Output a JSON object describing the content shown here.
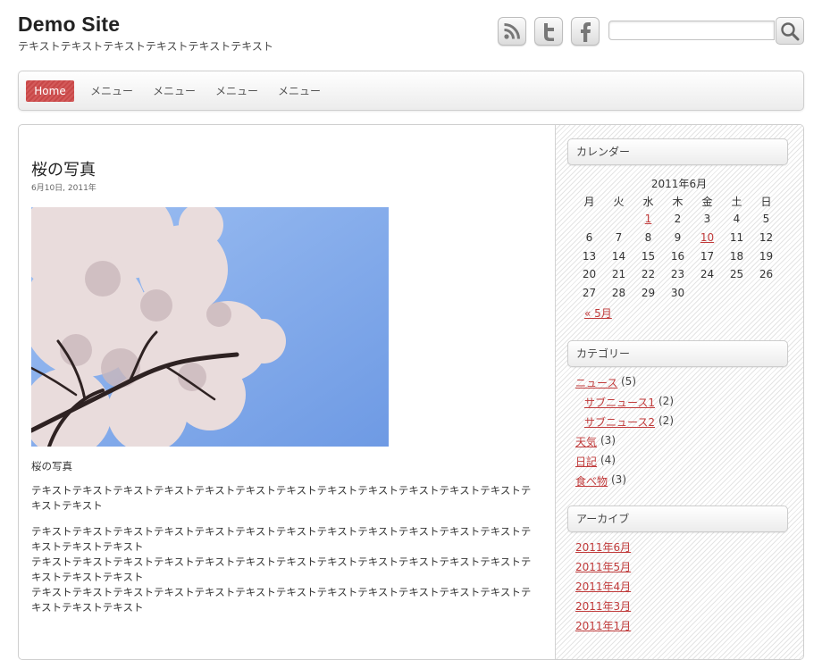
{
  "header": {
    "site_title": "Demo Site",
    "tagline": "テキストテキストテキストテキストテキストテキスト",
    "social_icons": [
      "rss-icon",
      "twitter-icon",
      "facebook-icon"
    ],
    "search": {
      "value": "",
      "placeholder": ""
    }
  },
  "nav": {
    "items": [
      "Home",
      "メニュー",
      "メニュー",
      "メニュー",
      "メニュー"
    ],
    "active": "Home",
    "accent_color": "#cf5050"
  },
  "post": {
    "title": "桜の写真",
    "date": "6月10日, 2011年",
    "caption": "桜の写真",
    "paragraphs": [
      "テキストテキストテキストテキストテキストテキストテキストテキストテキストテキストテキストテキストテキストテキスト",
      "テキストテキストテキストテキストテキストテキストテキストテキストテキストテキストテキストテキストテキストテキストテキスト\nテキストテキストテキストテキストテキストテキストテキストテキストテキストテキストテキストテキストテキストテキストテキスト\nテキストテキストテキストテキストテキストテキストテキストテキストテキストテキストテキストテキストテキストテキストテキスト"
    ]
  },
  "sidebar": {
    "calendar": {
      "title": "カレンダー",
      "caption": "2011年6月",
      "weekdays": [
        "月",
        "火",
        "水",
        "木",
        "金",
        "土",
        "日"
      ],
      "weeks": [
        [
          "",
          "",
          "1",
          "2",
          "3",
          "4",
          "5"
        ],
        [
          "6",
          "7",
          "8",
          "9",
          "10",
          "11",
          "12"
        ],
        [
          "13",
          "14",
          "15",
          "16",
          "17",
          "18",
          "19"
        ],
        [
          "20",
          "21",
          "22",
          "23",
          "24",
          "25",
          "26"
        ],
        [
          "27",
          "28",
          "29",
          "30",
          "",
          "",
          ""
        ]
      ],
      "linked_days": [
        "1",
        "10"
      ],
      "prev_link": "« 5月"
    },
    "categories": {
      "title": "カテゴリー",
      "items": [
        {
          "label": "ニュース",
          "count": "(5)",
          "child": false
        },
        {
          "label": "サブニュース1",
          "count": "(2)",
          "child": true
        },
        {
          "label": "サブニュース2",
          "count": "(2)",
          "child": true
        },
        {
          "label": "天気",
          "count": "(3)",
          "child": false
        },
        {
          "label": "日記",
          "count": "(4)",
          "child": false
        },
        {
          "label": "食べ物",
          "count": "(3)",
          "child": false
        }
      ]
    },
    "archives": {
      "title": "アーカイブ",
      "items": [
        "2011年6月",
        "2011年5月",
        "2011年4月",
        "2011年3月",
        "2011年1月"
      ]
    }
  },
  "colors": {
    "link": "#c03a3a",
    "text": "#333333",
    "sky": "#8fb6ee"
  }
}
